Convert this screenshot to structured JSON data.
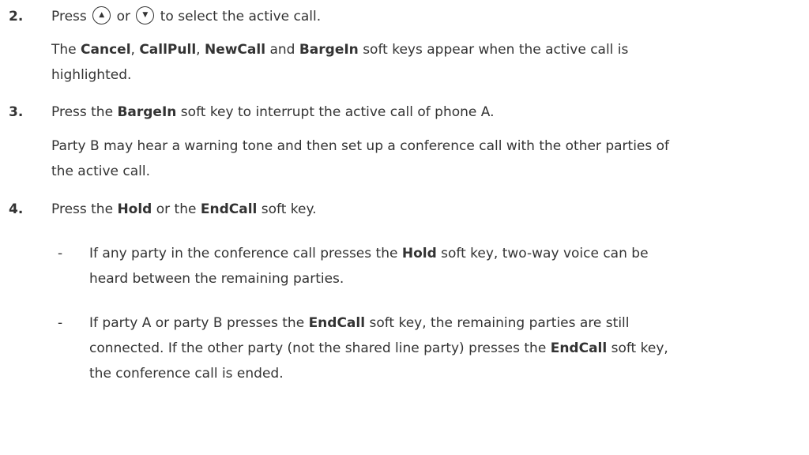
{
  "steps": [
    {
      "number": "2.",
      "line1": {
        "prefix": "Press",
        "or": "or",
        "suffix": "to select the active call.",
        "up_key_icon": "up-arrow-key-icon",
        "down_key_icon": "down-arrow-key-icon"
      },
      "para": {
        "t1": "The ",
        "b1": "Cancel",
        "t2": ", ",
        "b2": "CallPull",
        "t3": ", ",
        "b3": "NewCall",
        "t4": " and ",
        "b4": "BargeIn",
        "t5": " soft keys appear when the active call is",
        "line2": "highlighted."
      }
    },
    {
      "number": "3.",
      "line1": {
        "t1": "Press the ",
        "b1": "BargeIn",
        "t2": " soft key to interrupt the active call of phone A."
      },
      "para": {
        "line1": "Party B may hear a warning tone and then set up a conference call with the other parties of",
        "line2": "the active call."
      }
    },
    {
      "number": "4.",
      "line1": {
        "t1": "Press the ",
        "b1": "Hold",
        "t2": " or the ",
        "b2": "EndCall",
        "t3": " soft key."
      },
      "bullets": [
        {
          "dash": "-",
          "t1": "If any party in the conference call presses the ",
          "b1": "Hold",
          "t2": " soft key, two-way voice can be",
          "line2": "heard between the remaining parties."
        },
        {
          "dash": "-",
          "t1": "If party A or party B presses the ",
          "b1": "EndCall",
          "t2": " soft key, the remaining parties are still",
          "l2a": "connected. If the other party (not the shared line party) presses the ",
          "l2b": "EndCall",
          "l2c": " soft key,",
          "line3": "the conference call is ended."
        }
      ]
    }
  ]
}
